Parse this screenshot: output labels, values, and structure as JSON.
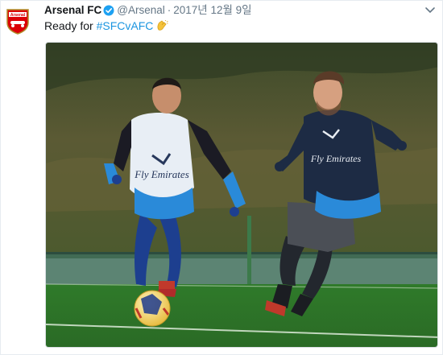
{
  "tweet": {
    "author_name": "Arsenal FC",
    "handle": "@Arsenal",
    "separator": "·",
    "date": "2017년 12월 9일",
    "text_prefix": "Ready for",
    "hashtag": "#SFCvAFC",
    "verified": true,
    "emoji": "clapping-hands-icon",
    "avatar_crest_text": "Arsenal",
    "media": {
      "shirt_sponsor_left": "Fly Emirates",
      "shirt_sponsor_right": "Fly Emirates"
    }
  },
  "colors": {
    "link": "#1b95e0",
    "verified_badge": "#1da1f2",
    "crest_red": "#db0007",
    "bib_white": "#e8eef5",
    "kit_blue": "#2a8ad9",
    "kit_navy": "#1d2b44",
    "pitch_green": "#2f7a2a"
  }
}
